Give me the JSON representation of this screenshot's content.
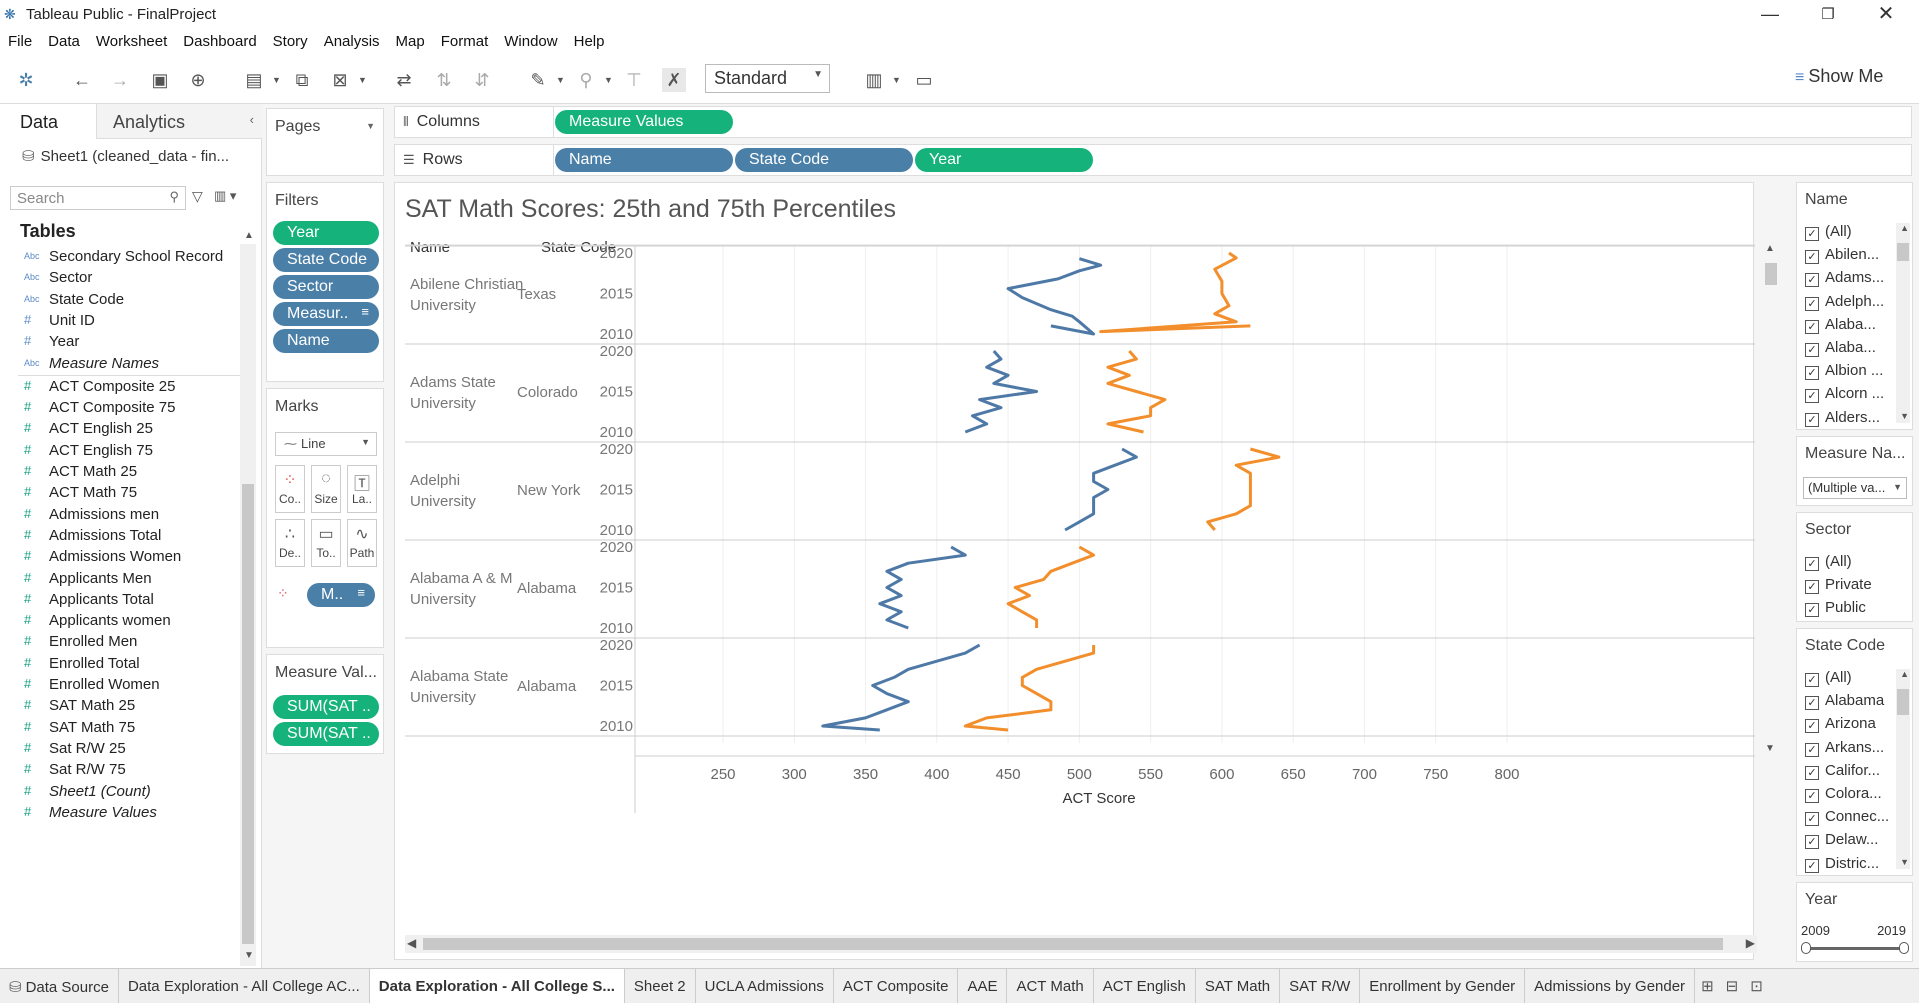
{
  "window": {
    "title": "Tableau Public - FinalProject"
  },
  "menu": [
    "File",
    "Data",
    "Worksheet",
    "Dashboard",
    "Story",
    "Analysis",
    "Map",
    "Format",
    "Window",
    "Help"
  ],
  "toolbar": {
    "view_mode": "Standard",
    "show_me": "Show Me"
  },
  "data_pane": {
    "tab_data": "Data",
    "tab_analytics": "Analytics",
    "datasource": "Sheet1 (cleaned_data - fin...",
    "search_placeholder": "Search",
    "tables_header": "Tables",
    "dimensions": [
      {
        "type": "Abc",
        "label": "Secondary School Record"
      },
      {
        "type": "Abc",
        "label": "Sector"
      },
      {
        "type": "Abc",
        "label": "State Code"
      },
      {
        "type": "#",
        "label": "Unit ID"
      },
      {
        "type": "#",
        "label": "Year"
      },
      {
        "type": "Abc",
        "label": "Measure Names"
      }
    ],
    "measures": [
      {
        "label": "ACT Composite 25"
      },
      {
        "label": "ACT Composite 75"
      },
      {
        "label": "ACT English 25"
      },
      {
        "label": "ACT English 75"
      },
      {
        "label": "ACT Math 25"
      },
      {
        "label": "ACT Math 75"
      },
      {
        "label": "Admissions men"
      },
      {
        "label": "Admissions Total"
      },
      {
        "label": "Admissions Women"
      },
      {
        "label": "Applicants Men"
      },
      {
        "label": "Applicants Total"
      },
      {
        "label": "Applicants women"
      },
      {
        "label": "Enrolled Men"
      },
      {
        "label": "Enrolled Total"
      },
      {
        "label": "Enrolled Women"
      },
      {
        "label": "SAT Math 25"
      },
      {
        "label": "SAT Math 75"
      },
      {
        "label": "Sat R/W 25"
      },
      {
        "label": "Sat R/W 75"
      },
      {
        "label": "Sheet1 (Count)"
      },
      {
        "label": "Measure Values"
      }
    ]
  },
  "pages_card": {
    "label": "Pages"
  },
  "filters_card": {
    "label": "Filters",
    "pills": [
      {
        "label": "Year",
        "color": "green"
      },
      {
        "label": "State Code",
        "color": "blue"
      },
      {
        "label": "Sector",
        "color": "blue"
      },
      {
        "label": "Measur..",
        "color": "blue"
      },
      {
        "label": "Name",
        "color": "blue"
      }
    ]
  },
  "marks_card": {
    "label": "Marks",
    "mark_type": "Line",
    "buttons": [
      {
        "label": "Co..",
        "icon": "color-icon"
      },
      {
        "label": "Size",
        "icon": "size-icon"
      },
      {
        "label": "La..",
        "icon": "label-icon"
      },
      {
        "label": "De..",
        "icon": "detail-icon"
      },
      {
        "label": "To..",
        "icon": "tooltip-icon"
      },
      {
        "label": "Path",
        "icon": "path-icon"
      }
    ],
    "color_pill": "M.."
  },
  "measure_values_card": {
    "label": "Measure Val...",
    "pills": [
      "SUM(SAT ..",
      "SUM(SAT .."
    ]
  },
  "columns_shelf": {
    "label": "Columns",
    "pills": [
      "Measure Values"
    ]
  },
  "rows_shelf": {
    "label": "Rows",
    "pills": [
      "Name",
      "State Code",
      "Year"
    ]
  },
  "viz": {
    "title": "SAT Math Scores: 25th and 75th Percentiles",
    "col_name": "Name",
    "col_state": "State Code",
    "x_axis_label": "ACT Score"
  },
  "chart_data": {
    "type": "line",
    "title": "SAT Math Scores: 25th and 75th Percentiles",
    "xlabel": "ACT Score",
    "xlim": [
      200,
      820
    ],
    "x_ticks": [
      250,
      300,
      350,
      400,
      450,
      500,
      550,
      600,
      650,
      700,
      750,
      800
    ],
    "year_ticks": [
      "2020",
      "2015",
      "2010"
    ],
    "colors": {
      "p25": "#4e79a7",
      "p75": "#f28e2b"
    },
    "rows": [
      {
        "name": "Abilene Christian University",
        "name_lines": [
          "Abilene Christian",
          "University"
        ],
        "state": "Texas",
        "p25": [
          [
            2011,
            480
          ],
          [
            2010,
            510
          ],
          [
            2011.5,
            500
          ],
          [
            2012.2,
            495
          ],
          [
            2013,
            480
          ],
          [
            2014.5,
            460
          ],
          [
            2015.6,
            450
          ],
          [
            2016.8,
            485
          ],
          [
            2017.8,
            500
          ],
          [
            2018.5,
            515
          ],
          [
            2019.3,
            500
          ]
        ],
        "p75": [
          [
            2011,
            620
          ],
          [
            2010.3,
            515
          ],
          [
            2011.5,
            610
          ],
          [
            2012.5,
            595
          ],
          [
            2013.5,
            605
          ],
          [
            2015,
            600
          ],
          [
            2016.5,
            600
          ],
          [
            2018,
            595
          ],
          [
            2019.4,
            610
          ],
          [
            2020,
            605
          ]
        ]
      },
      {
        "name": "Adams State University",
        "name_lines": [
          "Adams State",
          "University"
        ],
        "state": "Colorado",
        "p25": [
          [
            2010,
            420
          ],
          [
            2011,
            435
          ],
          [
            2012,
            425
          ],
          [
            2013,
            445
          ],
          [
            2014,
            430
          ],
          [
            2015,
            470
          ],
          [
            2016,
            440
          ],
          [
            2017,
            450
          ],
          [
            2018,
            435
          ],
          [
            2019,
            445
          ],
          [
            2020,
            440
          ]
        ],
        "p75": [
          [
            2010,
            545
          ],
          [
            2011,
            520
          ],
          [
            2012,
            550
          ],
          [
            2013,
            550
          ],
          [
            2014,
            560
          ],
          [
            2015,
            540
          ],
          [
            2016,
            520
          ],
          [
            2017,
            535
          ],
          [
            2018,
            520
          ],
          [
            2019,
            540
          ],
          [
            2020,
            535
          ]
        ]
      },
      {
        "name": "Adelphi University",
        "name_lines": [
          "Adelphi",
          "University"
        ],
        "state": "New York",
        "p25": [
          [
            2010,
            490
          ],
          [
            2011,
            500
          ],
          [
            2012,
            510
          ],
          [
            2013,
            510
          ],
          [
            2014,
            510
          ],
          [
            2015,
            520
          ],
          [
            2016,
            510
          ],
          [
            2017,
            510
          ],
          [
            2018,
            525
          ],
          [
            2019,
            540
          ],
          [
            2020,
            530
          ]
        ],
        "p75": [
          [
            2010,
            595
          ],
          [
            2011,
            590
          ],
          [
            2012,
            610
          ],
          [
            2013,
            620
          ],
          [
            2014,
            620
          ],
          [
            2015,
            620
          ],
          [
            2016,
            620
          ],
          [
            2017,
            620
          ],
          [
            2018,
            610
          ],
          [
            2019,
            640
          ],
          [
            2020,
            620
          ]
        ]
      },
      {
        "name": "Alabama A & M University",
        "name_lines": [
          "Alabama A & M",
          "University"
        ],
        "state": "Alabama",
        "p25": [
          [
            2010,
            380
          ],
          [
            2011,
            365
          ],
          [
            2012,
            375
          ],
          [
            2013,
            360
          ],
          [
            2014,
            375
          ],
          [
            2015,
            365
          ],
          [
            2016,
            375
          ],
          [
            2017,
            365
          ],
          [
            2018,
            380
          ],
          [
            2019,
            420
          ],
          [
            2020,
            410
          ]
        ],
        "p75": [
          [
            2010,
            470
          ],
          [
            2011,
            470
          ],
          [
            2012,
            460
          ],
          [
            2013,
            450
          ],
          [
            2014,
            465
          ],
          [
            2015,
            455
          ],
          [
            2016,
            475
          ],
          [
            2017,
            480
          ],
          [
            2018,
            495
          ],
          [
            2019,
            510
          ],
          [
            2020,
            500
          ]
        ]
      },
      {
        "name": "Alabama State University",
        "name_lines": [
          "Alabama State",
          "University"
        ],
        "state": "Alabama",
        "p25": [
          [
            2009.5,
            360
          ],
          [
            2010,
            320
          ],
          [
            2011,
            350
          ],
          [
            2012,
            365
          ],
          [
            2013,
            380
          ],
          [
            2014,
            365
          ],
          [
            2015,
            355
          ],
          [
            2016,
            370
          ],
          [
            2017,
            380
          ],
          [
            2018,
            400
          ],
          [
            2019,
            420
          ],
          [
            2020,
            430
          ]
        ],
        "p75": [
          [
            2009.5,
            450
          ],
          [
            2010,
            420
          ],
          [
            2011,
            435
          ],
          [
            2012,
            480
          ],
          [
            2013,
            480
          ],
          [
            2014,
            470
          ],
          [
            2015,
            460
          ],
          [
            2016,
            460
          ],
          [
            2017,
            470
          ],
          [
            2018,
            490
          ],
          [
            2019,
            510
          ],
          [
            2020,
            510
          ]
        ]
      }
    ]
  },
  "right_filters": {
    "name": {
      "title": "Name",
      "items": [
        "(All)",
        "Abilen...",
        "Adams...",
        "Adelph...",
        "Alaba...",
        "Alaba...",
        "Albion ...",
        "Alcorn ...",
        "Alders..."
      ]
    },
    "measure_names": {
      "title": "Measure Na...",
      "value": "(Multiple va..."
    },
    "sector": {
      "title": "Sector",
      "items": [
        "(All)",
        "Private",
        "Public"
      ]
    },
    "state_code": {
      "title": "State Code",
      "items": [
        "(All)",
        "Alabama",
        "Arizona",
        "Arkans...",
        "Califor...",
        "Colora...",
        "Connec...",
        "Delaw...",
        "Distric..."
      ]
    },
    "year": {
      "title": "Year",
      "min": "2009",
      "max": "2019"
    }
  },
  "bottom_tabs": [
    "Data Source",
    "Data Exploration - All College AC...",
    "Data Exploration - All College S...",
    "Sheet 2",
    "UCLA Admissions",
    "ACT Composite",
    "AAE",
    "ACT Math",
    "ACT English",
    "SAT Math",
    "SAT R/W",
    "Enrollment by Gender",
    "Admissions by Gender"
  ],
  "active_tab_index": 2
}
